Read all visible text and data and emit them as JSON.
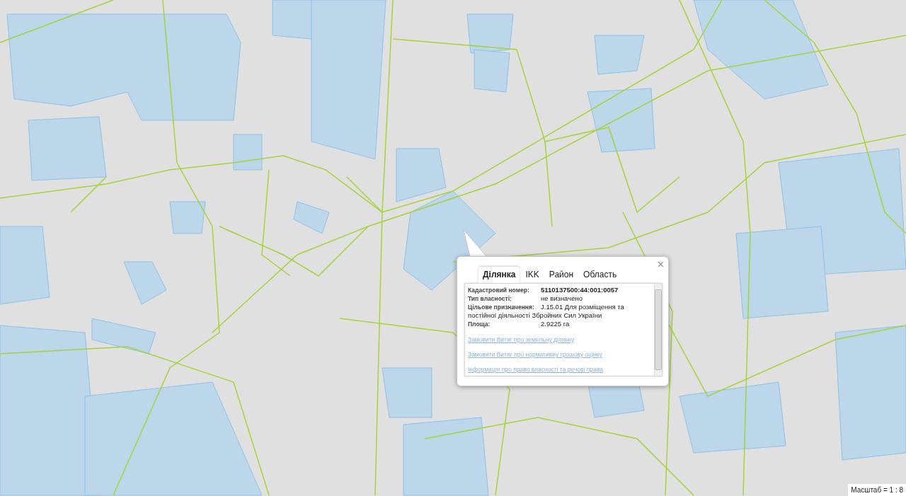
{
  "popup": {
    "close": "×",
    "tabs": [
      {
        "label": "Ділянка",
        "selected": true
      },
      {
        "label": "IKK",
        "selected": false
      },
      {
        "label": "Район",
        "selected": false
      },
      {
        "label": "Область",
        "selected": false
      }
    ],
    "fields": [
      {
        "label": "Кадастровий номер:",
        "value": "5110137500:44:001:0057",
        "bold": true
      },
      {
        "label": "Тип власності:",
        "value": "не визначено",
        "bold": false
      },
      {
        "label": "Цільове призначення:",
        "value": "J.15.01 Для розміщення та постійної діяльності Збройних Сил України",
        "bold": false
      },
      {
        "label": "Площа:",
        "value": "2.9225 га",
        "bold": false
      }
    ],
    "links": [
      "Замовити Витяг про земельну ділянку",
      "Замовити Витяг про нормативну грошову оцінку",
      "Інформація про право власності та речові права"
    ]
  },
  "scale": {
    "label": "Масштаб = 1 : 8"
  }
}
